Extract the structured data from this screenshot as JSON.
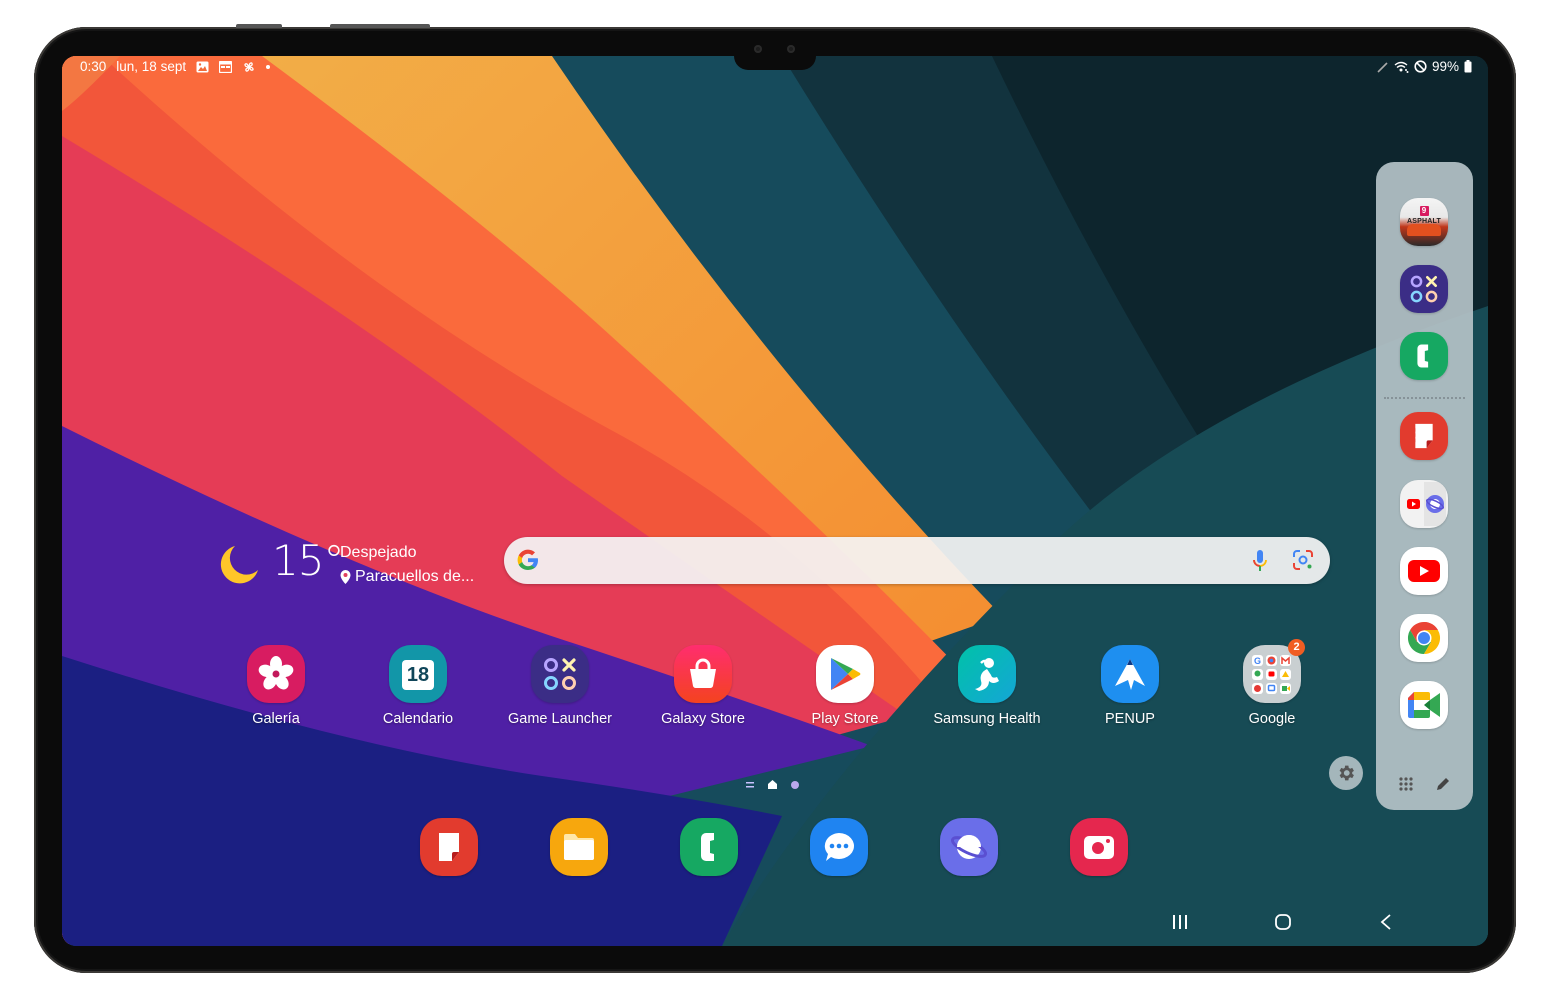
{
  "status_bar": {
    "time": "0:30",
    "date": "lun, 18 sept",
    "left_icons": [
      "gallery-notification-icon",
      "calendar-notification-icon",
      "pinwheel-notification-icon",
      "more-notifications-dot-icon"
    ],
    "right_icons": [
      "s-pen-icon",
      "wifi-icon",
      "do-not-disturb-icon",
      "battery-icon"
    ],
    "battery": "99%"
  },
  "weather": {
    "icon": "moon-icon",
    "temperature": "15°",
    "condition": "Despejado",
    "location": "Paracuellos de..."
  },
  "search": {
    "placeholder": "",
    "value": "",
    "icons": [
      "google-g-icon",
      "microphone-icon",
      "google-lens-icon"
    ]
  },
  "apps": [
    {
      "label": "Galería",
      "icon": "gallery-icon",
      "color": "#d81c61"
    },
    {
      "label": "Calendario",
      "icon": "calendar-icon",
      "color": "#1296a8",
      "day": "18"
    },
    {
      "label": "Game Launcher",
      "icon": "game-launcher-icon",
      "color": "#3b2d86"
    },
    {
      "label": "Galaxy Store",
      "icon": "galaxy-store-icon",
      "color": "#f2294f"
    },
    {
      "label": "Play Store",
      "icon": "play-store-icon",
      "color": "#ffffff"
    },
    {
      "label": "Samsung Health",
      "icon": "samsung-health-icon",
      "color": "#1bb3a0"
    },
    {
      "label": "PENUP",
      "icon": "penup-icon",
      "color": "#1e8ff0"
    },
    {
      "label": "Google",
      "icon": "google-folder-icon",
      "color": "#c9cfd1",
      "badge": "2"
    }
  ],
  "pager": {
    "pages": [
      "menu-page-indicator",
      "home-page-indicator",
      "page-dot"
    ],
    "active_index": 1
  },
  "dock": [
    {
      "name": "samsung-notes",
      "icon": "samsung-notes-icon",
      "color": "#e23b2e"
    },
    {
      "name": "my-files",
      "icon": "my-files-icon",
      "color": "#f7a70d"
    },
    {
      "name": "phone",
      "icon": "phone-icon",
      "color": "#16a862"
    },
    {
      "name": "messages",
      "icon": "messages-icon",
      "color": "#1f84f1"
    },
    {
      "name": "samsung-internet",
      "icon": "samsung-internet-icon",
      "color": "#6a6ee9"
    },
    {
      "name": "camera",
      "icon": "camera-icon",
      "color": "#e5274e"
    }
  ],
  "edge_panel": {
    "items": [
      {
        "name": "asphalt-9",
        "icon": "asphalt-9-icon",
        "text": "ASPHALT",
        "num": "9"
      },
      {
        "name": "game-launcher",
        "icon": "game-launcher-icon",
        "color": "#3b2d86"
      },
      {
        "name": "phone",
        "icon": "phone-icon",
        "color": "#16a862"
      },
      {
        "name": "samsung-notes",
        "icon": "samsung-notes-icon",
        "color": "#e23b2e"
      },
      {
        "name": "youtube-internet-pair",
        "icon": "app-pair-icon",
        "color": "#f2f2f2"
      },
      {
        "name": "youtube",
        "icon": "youtube-icon",
        "color": "#ffffff"
      },
      {
        "name": "chrome",
        "icon": "chrome-icon",
        "color": "#ffffff"
      },
      {
        "name": "google-meet",
        "icon": "google-meet-icon",
        "color": "#ffffff"
      }
    ],
    "bottom_icons": [
      "all-apps-grid-icon",
      "edit-pencil-icon"
    ],
    "settings_icon": "gear-icon"
  },
  "nav_bar": {
    "buttons": [
      "recent-apps-icon",
      "home-icon",
      "back-icon"
    ]
  }
}
